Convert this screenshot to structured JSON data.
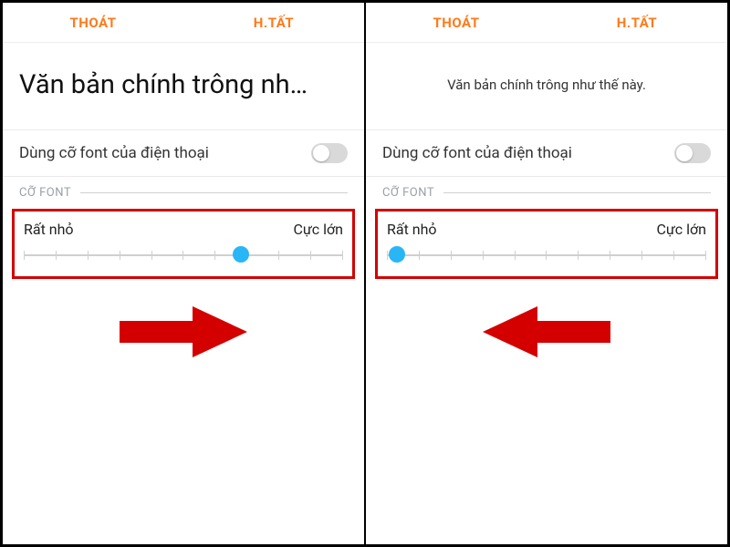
{
  "colors": {
    "accent": "#ff7a1a",
    "highlight": "#d40000",
    "slider_thumb": "#29b6f6"
  },
  "left": {
    "topbar": {
      "exit": "THOÁT",
      "done": "H.TẤT"
    },
    "preview_text": "Văn bản chính trông nh…",
    "toggle_row": {
      "label": "Dùng cỡ font của điện thoại",
      "state": "off"
    },
    "section_header": "CỠ FONT",
    "slider": {
      "min_label": "Rất nhỏ",
      "max_label": "Cực lớn",
      "position_pct": 68
    },
    "arrow_direction": "right"
  },
  "right": {
    "topbar": {
      "exit": "THOÁT",
      "done": "H.TẤT"
    },
    "preview_text": "Văn bản chính trông như thế này.",
    "toggle_row": {
      "label": "Dùng cỡ font của điện thoại",
      "state": "off"
    },
    "section_header": "CỠ FONT",
    "slider": {
      "min_label": "Rất nhỏ",
      "max_label": "Cực lớn",
      "position_pct": 3
    },
    "arrow_direction": "left"
  }
}
